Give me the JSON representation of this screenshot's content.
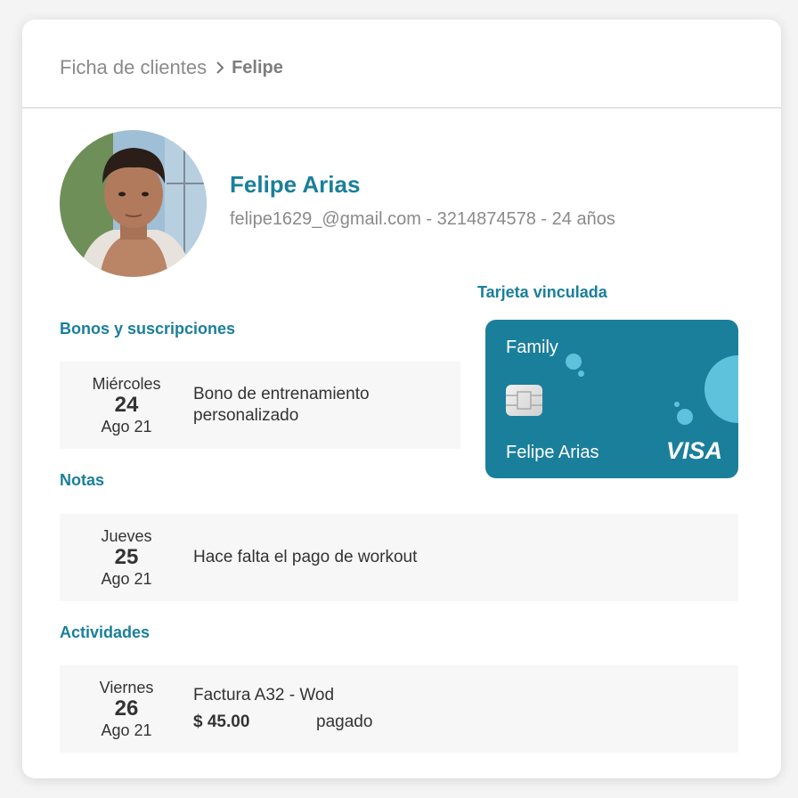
{
  "breadcrumb": {
    "parent": "Ficha de clientes",
    "current": "Felipe"
  },
  "profile": {
    "name": "Felipe Arias",
    "info": "felipe1629_@gmail.com - 3214874578 - 24 años"
  },
  "linked_card": {
    "title": "Tarjeta vinculada",
    "plan": "Family",
    "holder": "Felipe Arias",
    "brand": "VISA",
    "color": "#1a7f9b"
  },
  "sections": {
    "bonos": {
      "title": "Bonos y suscripciones",
      "item": {
        "dow": "Miércoles",
        "day": "24",
        "month": "Ago 21",
        "text": "Bono de entrenamiento personalizado"
      }
    },
    "notas": {
      "title": "Notas",
      "item": {
        "dow": "Jueves",
        "day": "25",
        "month": "Ago 21",
        "text": "Hace falta el pago de workout"
      }
    },
    "actividades": {
      "title": "Actividades",
      "item": {
        "dow": "Viernes",
        "day": "26",
        "month": "Ago 21",
        "text": "Factura A32 - Wod",
        "amount": "$ 45.00",
        "status": "pagado"
      }
    }
  },
  "colors": {
    "accent": "#1a7f9b",
    "row_bg": "#f7f7f7"
  }
}
